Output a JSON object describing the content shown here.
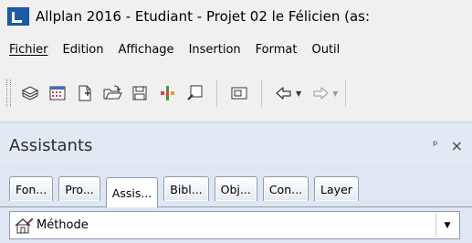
{
  "window": {
    "title": "Allplan 2016 - Etudiant - Projet 02  le Félicien (as:"
  },
  "menubar": {
    "items": [
      {
        "label": "Fichier"
      },
      {
        "label": "Edition"
      },
      {
        "label": "Affichage"
      },
      {
        "label": "Insertion"
      },
      {
        "label": "Format"
      },
      {
        "label": "Outil"
      }
    ]
  },
  "toolbar": {
    "icons": [
      "layers-icon",
      "grid-icon",
      "new-document-icon",
      "open-folder-icon",
      "save-icon",
      "color-bars-icon",
      "zoom-icon",
      "print-preview-icon",
      "undo-icon",
      "redo-icon"
    ]
  },
  "panel": {
    "title": "Assistants",
    "pin_glyph": "ᵖ",
    "close_glyph": "×"
  },
  "tabs": {
    "items": [
      {
        "label": "Fon..."
      },
      {
        "label": "Pro..."
      },
      {
        "label": "Assis..."
      },
      {
        "label": "Bibl..."
      },
      {
        "label": "Obj..."
      },
      {
        "label": "Con..."
      },
      {
        "label": "Layer"
      }
    ],
    "active_index": 2
  },
  "methode": {
    "label": "Méthode"
  },
  "colors": {
    "panel_bg": "#dfe6f2",
    "chrome_bg": "#f0f0f0",
    "tab_border": "#8c9cb5",
    "accent_blue": "#1e5aa8"
  }
}
